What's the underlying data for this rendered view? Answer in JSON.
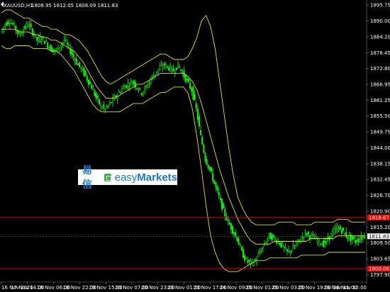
{
  "header": {
    "symbol": "XAUUSD,H1",
    "ohlc": "1808.95 1812.05 1808.09 1811.83"
  },
  "logo": {
    "cn": "易信",
    "en_a": "easy",
    "en_b": "Markets"
  },
  "colors": {
    "background": "#000000",
    "bull": "#00ff00",
    "bear": "#00ff00",
    "bands": "#e6e600",
    "level_line": "#ff0000",
    "grid": "#404040"
  },
  "chart_data": {
    "type": "candlestick",
    "title": "XAUUSD,H1",
    "y_axis": {
      "ylim": [
        1795.2,
        1897.6
      ],
      "ticks": [
        1895.75,
        1890.0,
        1884.2,
        1878.45,
        1872.8,
        1866.95,
        1861.25,
        1855.5,
        1849.75,
        1844.0,
        1838.15,
        1832.45,
        1826.7,
        1820.9,
        1815.2,
        1809.5,
        1803.65,
        1797.9
      ]
    },
    "x_axis": {
      "labels": [
        "16 Nov 2020",
        "17 Nov 14:00",
        "18 Nov 06:00",
        "18 Nov 22:00",
        "19 Nov 15:00",
        "20 Nov 07:00",
        "20 Nov 23:00",
        "23 Nov 01:00",
        "23 Nov 17:00",
        "24 Nov 09:00",
        "25 Nov 01:00",
        "25 Nov 03:00",
        "25 Nov 19:00",
        "26 Nov 11:00",
        "26 Nov 12:00"
      ]
    },
    "levels": [
      {
        "price": 1818.67,
        "label": "1818.67"
      },
      {
        "price": 1800.06,
        "label": "1800.06"
      }
    ],
    "current": {
      "price": 1811.83,
      "label": "1811.83"
    },
    "price_path": [
      1886,
      1889,
      1890,
      1888,
      1885,
      1887,
      1889,
      1886,
      1883,
      1884,
      1882,
      1880,
      1879,
      1881,
      1883,
      1880,
      1877,
      1874,
      1872,
      1869,
      1866,
      1862,
      1859,
      1858,
      1860,
      1862,
      1864,
      1866,
      1867,
      1868,
      1866,
      1864,
      1866,
      1869,
      1871,
      1873,
      1874,
      1873,
      1872,
      1874,
      1871,
      1868,
      1865,
      1858,
      1848,
      1840,
      1836,
      1831,
      1826,
      1821,
      1817,
      1814,
      1811,
      1806,
      1803,
      1802,
      1803,
      1806,
      1809,
      1812,
      1811,
      1810,
      1808,
      1806,
      1807,
      1809,
      1811,
      1813,
      1812,
      1811,
      1810,
      1809,
      1811,
      1813,
      1815,
      1814,
      1812,
      1811,
      1810,
      1811,
      1812
    ],
    "bollinger": {
      "upper": [
        1893,
        1894,
        1894,
        1893,
        1892,
        1891,
        1891,
        1890,
        1889,
        1888,
        1888,
        1887,
        1887,
        1886,
        1885,
        1885,
        1884,
        1883,
        1881,
        1879,
        1876,
        1873,
        1870,
        1868,
        1867,
        1868,
        1869,
        1870,
        1871,
        1872,
        1873,
        1874,
        1875,
        1876,
        1877,
        1878,
        1878,
        1877,
        1876,
        1876,
        1876,
        1877,
        1880,
        1884,
        1890,
        1892,
        1888,
        1880,
        1868,
        1856,
        1844,
        1834,
        1826,
        1822,
        1819,
        1817,
        1816,
        1816,
        1816,
        1816,
        1816,
        1817,
        1817,
        1817,
        1817,
        1816,
        1816,
        1816,
        1816,
        1817,
        1817,
        1817,
        1817,
        1817,
        1818,
        1818,
        1818,
        1817,
        1817,
        1817,
        1817
      ],
      "middle": [
        1887,
        1887,
        1887,
        1887,
        1886,
        1886,
        1886,
        1885,
        1885,
        1884,
        1884,
        1883,
        1883,
        1882,
        1881,
        1880,
        1879,
        1877,
        1875,
        1872,
        1869,
        1866,
        1864,
        1862,
        1862,
        1862,
        1863,
        1864,
        1865,
        1866,
        1867,
        1867,
        1868,
        1869,
        1870,
        1871,
        1871,
        1871,
        1871,
        1871,
        1871,
        1870,
        1868,
        1865,
        1860,
        1854,
        1848,
        1842,
        1836,
        1831,
        1826,
        1822,
        1818,
        1815,
        1812,
        1810,
        1809,
        1809,
        1809,
        1809,
        1810,
        1810,
        1810,
        1810,
        1810,
        1810,
        1810,
        1810,
        1811,
        1811,
        1811,
        1811,
        1811,
        1811,
        1812,
        1812,
        1812,
        1812,
        1812,
        1812,
        1812
      ],
      "lower": [
        1881,
        1880,
        1880,
        1881,
        1881,
        1881,
        1881,
        1880,
        1880,
        1880,
        1880,
        1879,
        1879,
        1878,
        1876,
        1874,
        1872,
        1869,
        1866,
        1863,
        1860,
        1858,
        1857,
        1857,
        1857,
        1857,
        1857,
        1858,
        1859,
        1860,
        1860,
        1860,
        1861,
        1862,
        1863,
        1864,
        1864,
        1865,
        1866,
        1866,
        1866,
        1864,
        1858,
        1848,
        1836,
        1823,
        1812,
        1806,
        1802,
        1800,
        1799,
        1799,
        1799,
        1800,
        1801,
        1802,
        1803,
        1803,
        1803,
        1804,
        1804,
        1804,
        1804,
        1804,
        1804,
        1804,
        1805,
        1805,
        1805,
        1805,
        1805,
        1805,
        1806,
        1806,
        1806,
        1806,
        1806,
        1806,
        1806,
        1806,
        1806
      ]
    }
  }
}
